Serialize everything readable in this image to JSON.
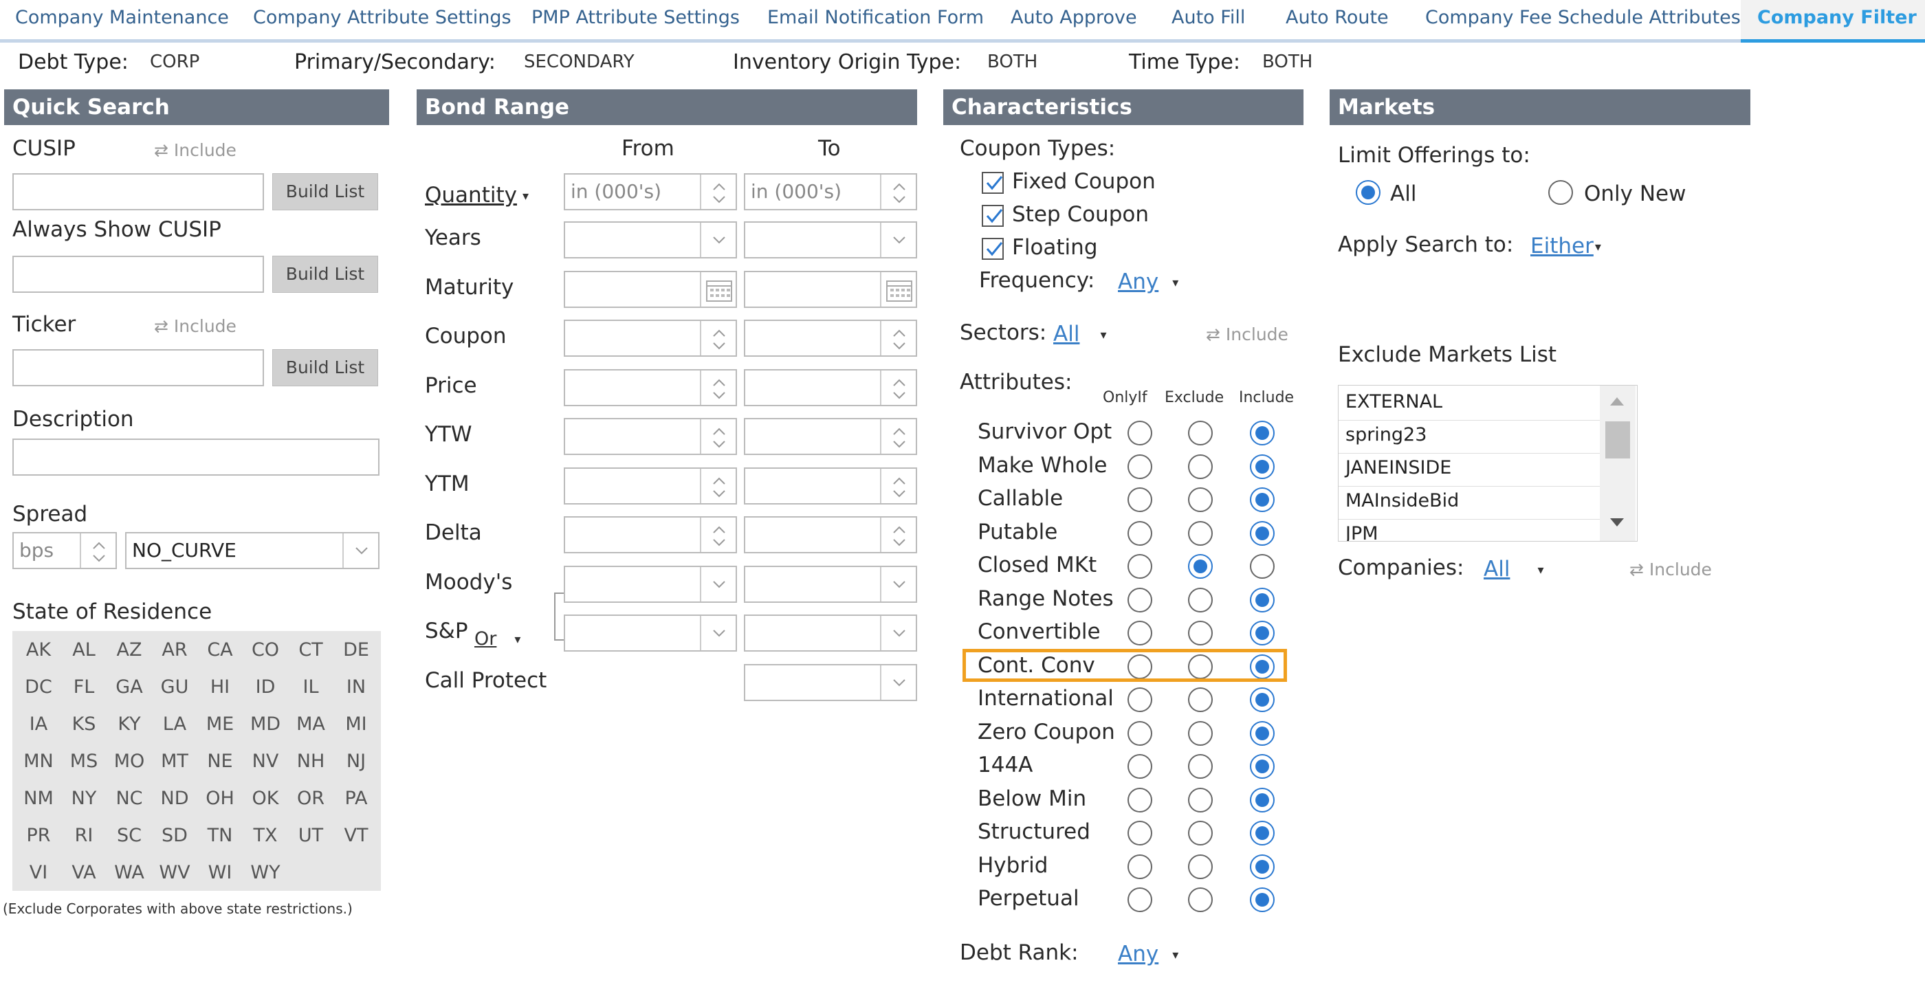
{
  "tabs": [
    {
      "label": "Company Maintenance",
      "active": false
    },
    {
      "label": "Company Attribute Settings",
      "active": false
    },
    {
      "label": "PMP Attribute Settings",
      "active": false
    },
    {
      "label": "Email Notification Form",
      "active": false
    },
    {
      "label": "Auto Approve",
      "active": false
    },
    {
      "label": "Auto Fill",
      "active": false
    },
    {
      "label": "Auto Route",
      "active": false
    },
    {
      "label": "Company Fee Schedule Attributes",
      "active": false
    },
    {
      "label": "Company Filter",
      "active": true
    }
  ],
  "header": {
    "debt_type_label": "Debt Type:",
    "debt_type_value": "CORP",
    "primary_label": "Primary/Secondary:",
    "primary_value": "SECONDARY",
    "origin_label": "Inventory Origin Type:",
    "origin_value": "BOTH",
    "time_label": "Time Type:",
    "time_value": "BOTH"
  },
  "quick_search": {
    "title": "Quick Search",
    "cusip_label": "CUSIP",
    "include_label": "Include",
    "build_list": "Build List",
    "always_show_label": "Always Show CUSIP",
    "ticker_label": "Ticker",
    "description_label": "Description",
    "spread_label": "Spread",
    "spread_placeholder": "bps",
    "curve_value": "NO_CURVE",
    "state_label": "State of Residence",
    "states": [
      "AK",
      "AL",
      "AZ",
      "AR",
      "CA",
      "CO",
      "CT",
      "DE",
      "DC",
      "FL",
      "GA",
      "GU",
      "HI",
      "ID",
      "IL",
      "IN",
      "IA",
      "KS",
      "KY",
      "LA",
      "ME",
      "MD",
      "MA",
      "MI",
      "MN",
      "MS",
      "MO",
      "MT",
      "NE",
      "NV",
      "NH",
      "NJ",
      "NM",
      "NY",
      "NC",
      "ND",
      "OH",
      "OK",
      "OR",
      "PA",
      "PR",
      "RI",
      "SC",
      "SD",
      "TN",
      "TX",
      "UT",
      "VT",
      "VI",
      "VA",
      "WA",
      "WV",
      "WI",
      "WY"
    ],
    "state_note": "(Exclude Corporates with above state restrictions.)"
  },
  "bond_range": {
    "title": "Bond Range",
    "from_label": "From",
    "to_label": "To",
    "quantity_label": "Quantity",
    "quantity_placeholder": "in (000's)",
    "rows": [
      "Years",
      "Maturity",
      "Coupon",
      "Price",
      "YTW",
      "YTM",
      "Delta",
      "Moody's",
      "S&P",
      "Call Protect"
    ],
    "sp_or": "Or"
  },
  "characteristics": {
    "title": "Characteristics",
    "coupon_types_label": "Coupon Types:",
    "coupons": [
      {
        "label": "Fixed Coupon",
        "checked": true
      },
      {
        "label": "Step Coupon",
        "checked": true
      },
      {
        "label": "Floating",
        "checked": true
      }
    ],
    "frequency_label": "Frequency:",
    "frequency_value": "Any",
    "sectors_label": "Sectors:",
    "sectors_value": "All",
    "include_label": "Include",
    "attributes_label": "Attributes:",
    "col_onlyif": "OnlyIf",
    "col_exclude": "Exclude",
    "col_include": "Include",
    "attributes": [
      {
        "label": "Survivor Opt",
        "sel": "include"
      },
      {
        "label": "Make Whole",
        "sel": "include"
      },
      {
        "label": "Callable",
        "sel": "include"
      },
      {
        "label": "Putable",
        "sel": "include"
      },
      {
        "label": "Closed MKt",
        "sel": "exclude"
      },
      {
        "label": "Range Notes",
        "sel": "include"
      },
      {
        "label": "Convertible",
        "sel": "include"
      },
      {
        "label": "Cont. Conv",
        "sel": "include",
        "highlight": true
      },
      {
        "label": "International",
        "sel": "include"
      },
      {
        "label": "Zero Coupon",
        "sel": "include"
      },
      {
        "label": "144A",
        "sel": "include"
      },
      {
        "label": "Below Min",
        "sel": "include"
      },
      {
        "label": "Structured",
        "sel": "include"
      },
      {
        "label": "Hybrid",
        "sel": "include"
      },
      {
        "label": "Perpetual",
        "sel": "include"
      }
    ],
    "debt_rank_label": "Debt Rank:",
    "debt_rank_value": "Any",
    "highlight_color": "#f0a020"
  },
  "markets": {
    "title": "Markets",
    "limit_label": "Limit Offerings to:",
    "opt_all": "All",
    "opt_only_new": "Only New",
    "apply_label": "Apply Search to:",
    "apply_value": "Either",
    "exclude_list_label": "Exclude Markets List",
    "exclude_list": [
      "EXTERNAL",
      "spring23",
      "JANEINSIDE",
      "MAInsideBid",
      "JPM"
    ],
    "companies_label": "Companies:",
    "companies_value": "All",
    "include_label": "Include"
  }
}
